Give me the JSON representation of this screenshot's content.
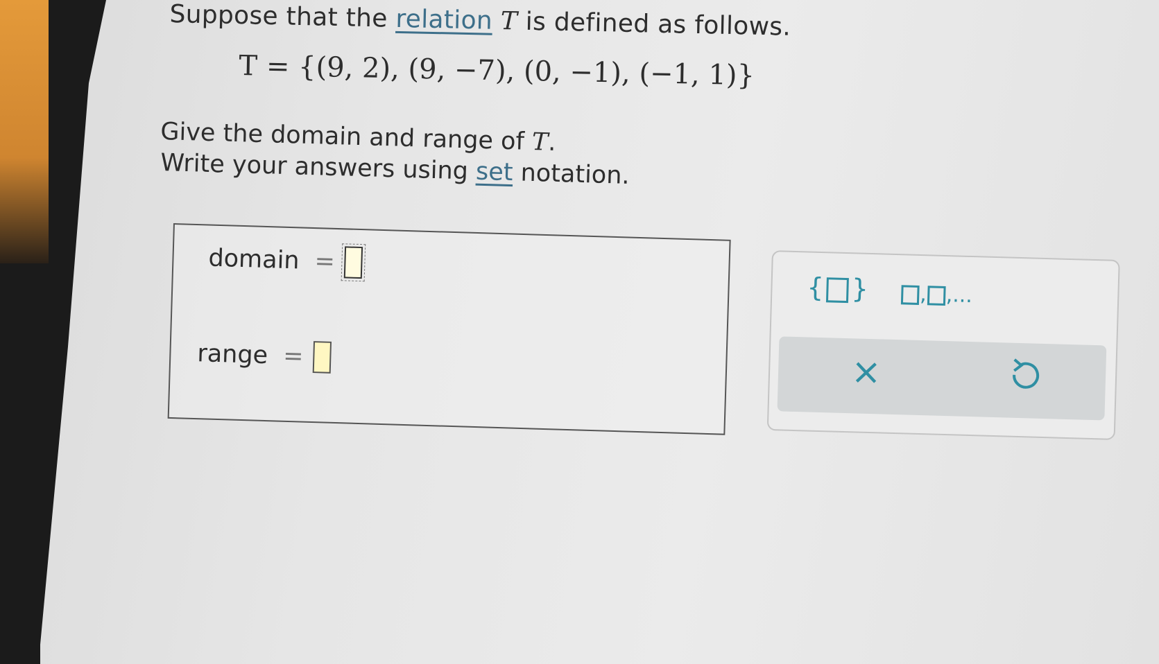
{
  "question": {
    "prefix": "Suppose that the",
    "link": "relation",
    "var": "T",
    "suffix": "is defined as follows."
  },
  "equation": "T = {(9, 2), (9, −7), (0, −1), (−1, 1)}",
  "instructions": {
    "line1_text": "Give the domain and range of",
    "line1_var": "T",
    "line1_end": ".",
    "line2_prefix": "Write your answers using",
    "line2_link": "set",
    "line2_suffix": "notation."
  },
  "answer": {
    "domain_label": "domain",
    "range_label": "range",
    "equals": "="
  },
  "palette": {
    "set_left": "{",
    "set_right": "}",
    "list_tail": ",...",
    "clear": "×",
    "accent_color": "#2f8fa3",
    "icons": [
      "set-builder-icon",
      "list-icon",
      "clear-icon",
      "undo-icon"
    ]
  }
}
